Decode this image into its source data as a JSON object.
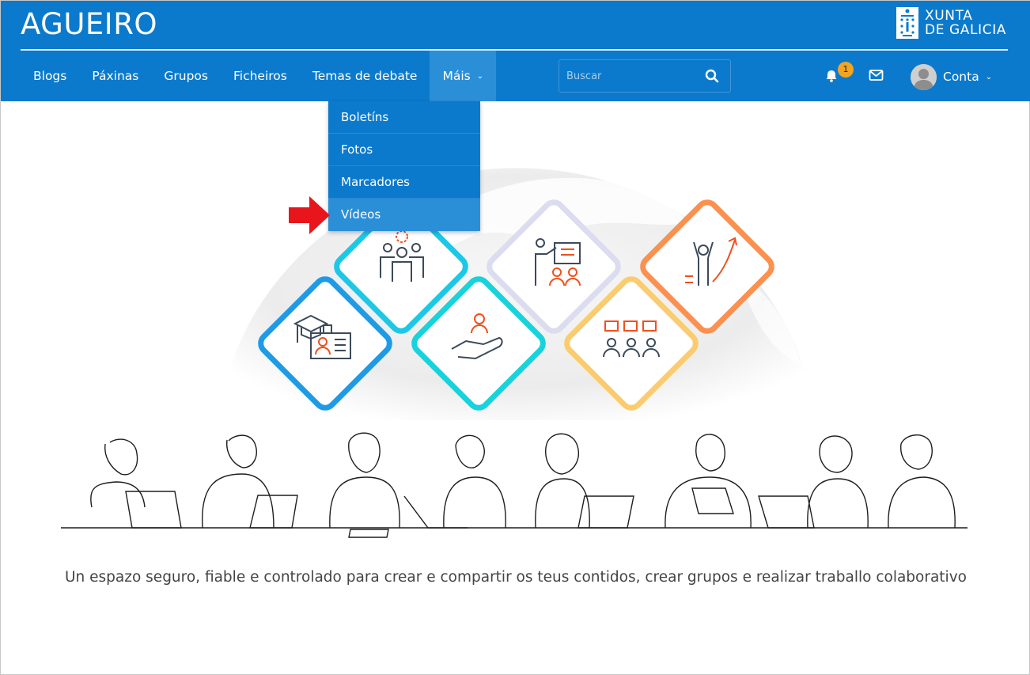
{
  "brand": {
    "title": "AGUEIRO",
    "org_line1": "XUNTA",
    "org_line2": "DE GALICIA"
  },
  "nav": {
    "items": [
      {
        "label": "Blogs"
      },
      {
        "label": "Páxinas"
      },
      {
        "label": "Grupos"
      },
      {
        "label": "Ficheiros"
      },
      {
        "label": "Temas de debate"
      },
      {
        "label": "Máis"
      }
    ]
  },
  "dropdown": {
    "items": [
      {
        "label": "Boletíns"
      },
      {
        "label": "Fotos"
      },
      {
        "label": "Marcadores"
      },
      {
        "label": "Vídeos"
      }
    ]
  },
  "search": {
    "placeholder": "Buscar",
    "value": ""
  },
  "notifications": {
    "count": "1"
  },
  "account": {
    "label": "Conta"
  },
  "main": {
    "tagline": "Un espazo seguro, fiable e controlado para crear e compartir os teus contidos, crear grupos e realizar traballo colaborativo"
  },
  "colors": {
    "header_bg": "#0b7acc",
    "active_bg": "#2b8fd8",
    "badge": "#f3a421",
    "arrow": "#e8161c",
    "tile_blue": "#1e9be6",
    "tile_cyan": "#18d2dc",
    "tile_lavender": "#dcdcf0",
    "tile_orange": "#fa9150",
    "tile_yellow": "#fbcc6e",
    "icon_orange": "#f0501e",
    "icon_dark": "#3c4a5a"
  },
  "icons": [
    "search-icon",
    "bell-icon",
    "mail-icon",
    "chevron-down-icon",
    "red-arrow-icon",
    "xunta-logo"
  ]
}
